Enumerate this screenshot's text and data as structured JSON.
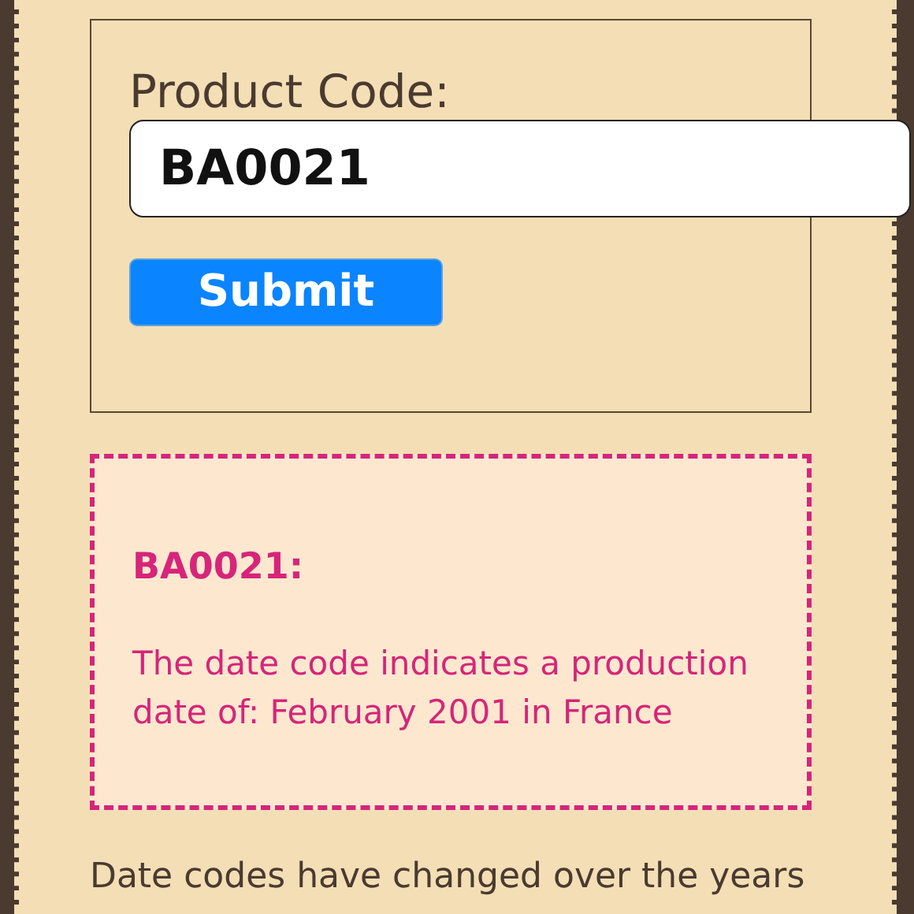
{
  "form": {
    "label": "Product Code:",
    "value": "BA0021",
    "button": "Submit"
  },
  "result": {
    "title": "BA0021:",
    "message": "The date code indicates a production date of: February 2001 in France"
  },
  "note": "Date codes have changed over the years"
}
